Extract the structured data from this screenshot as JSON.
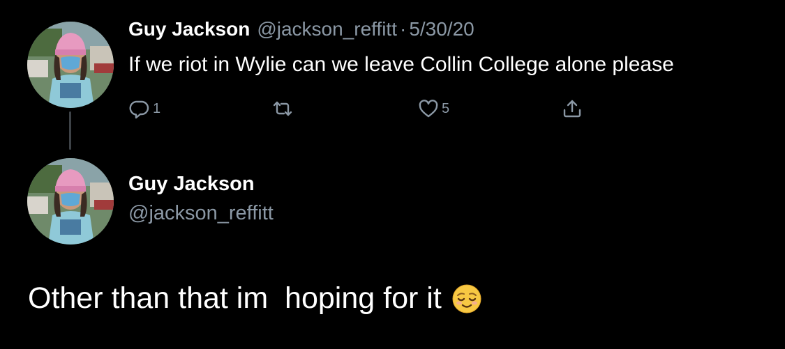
{
  "parent_tweet": {
    "display_name": "Guy Jackson",
    "handle": "@jackson_reffitt",
    "separator": "·",
    "timestamp": "5/30/20",
    "text": "If we riot in Wylie can we leave Collin College alone please",
    "actions": {
      "reply_count": "1",
      "retweet_count": "",
      "like_count": "5"
    },
    "icons": [
      "reply-icon",
      "retweet-icon",
      "heart-icon",
      "share-icon"
    ]
  },
  "main_tweet": {
    "display_name": "Guy Jackson",
    "handle": "@jackson_reffitt",
    "text": "Other than that im  hoping for it",
    "emoji": "relieved-face-emoji"
  },
  "colors": {
    "background": "#000000",
    "primary_text": "#ffffff",
    "secondary_text": "#8b98a5",
    "thread_line": "#3d4247"
  }
}
